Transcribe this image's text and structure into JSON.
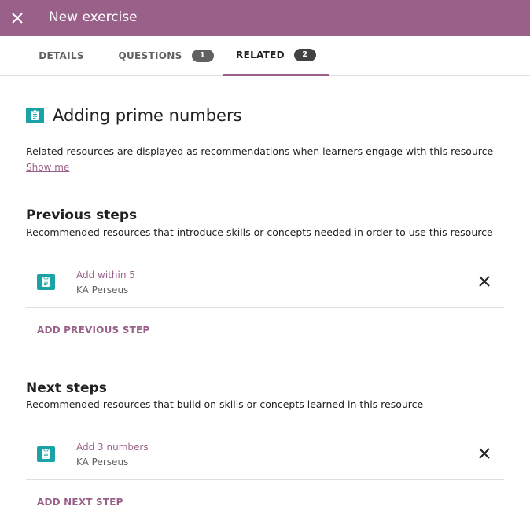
{
  "header": {
    "title": "New exercise",
    "close_icon": "close-icon"
  },
  "tabs": [
    {
      "label": "DETAILS"
    },
    {
      "label": "QUESTIONS",
      "count": "1"
    },
    {
      "label": "RELATED",
      "count": "2",
      "active": true
    }
  ],
  "resource": {
    "title": "Adding prime numbers",
    "icon": "exercise-icon"
  },
  "info": {
    "text": "Related resources are displayed as recommendations when learners engage with this resource",
    "link": "Show me"
  },
  "previous": {
    "title": "Previous steps",
    "description": "Recommended resources that introduce skills or concepts needed in order to use this resource",
    "items": [
      {
        "title": "Add within 5",
        "channel": "KA Perseus"
      }
    ],
    "add_label": "ADD PREVIOUS STEP"
  },
  "next": {
    "title": "Next steps",
    "description": "Recommended resources that build on skills or concepts learned in this resource",
    "items": [
      {
        "title": "Add 3 numbers",
        "channel": "KA Perseus"
      }
    ],
    "add_label": "ADD NEXT STEP"
  },
  "colors": {
    "brand": "#996189",
    "exercise_icon": "#1aa3a6"
  }
}
